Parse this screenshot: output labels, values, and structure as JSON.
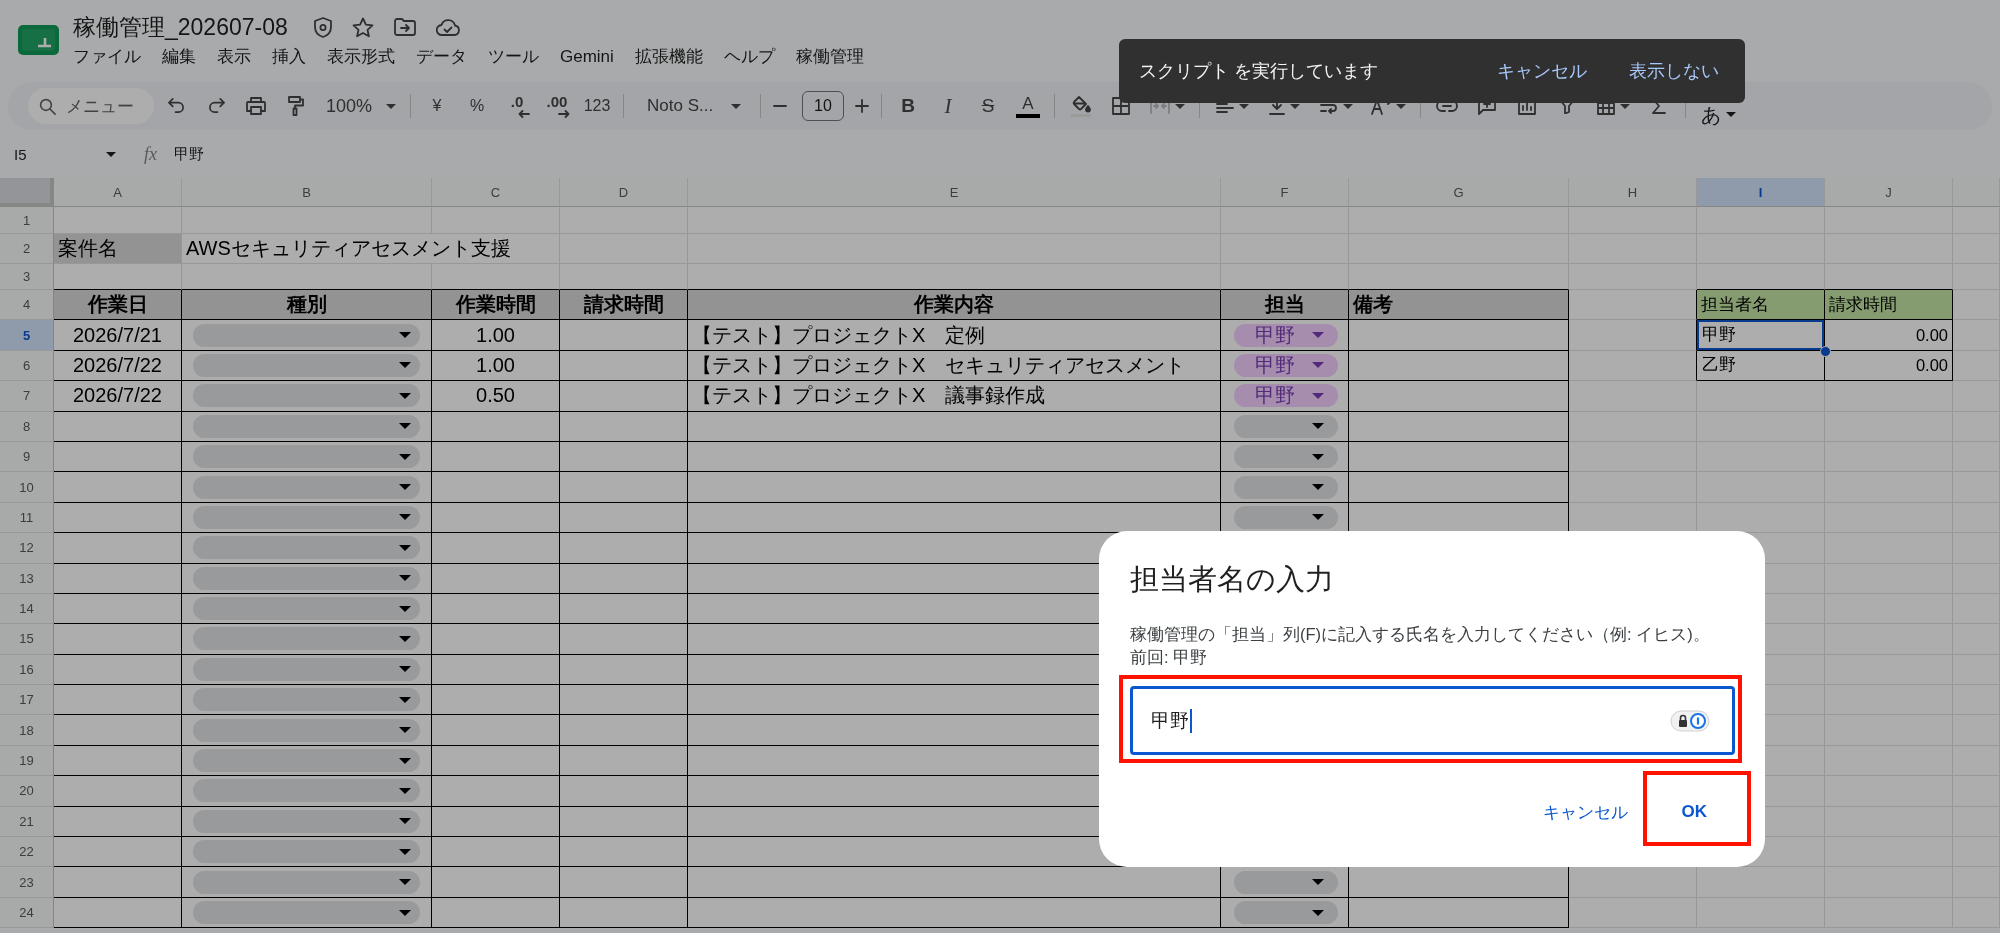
{
  "app": {
    "title": "稼働管理_202607-08",
    "menu": [
      "ファイル",
      "編集",
      "表示",
      "挿入",
      "表示形式",
      "データ",
      "ツール",
      "Gemini",
      "拡張機能",
      "ヘルプ",
      "稼働管理"
    ]
  },
  "toolbar": {
    "search": {
      "placeholder": "メニュー"
    },
    "zoom": "100%",
    "currency": "¥",
    "percent": "%",
    "decrease_decimal": ".0",
    "increase_decimal": ".00",
    "number_format": "123",
    "font": "Noto S...",
    "font_size": "10",
    "bold": "B",
    "italic": "I",
    "strikethrough": "S",
    "text_color": "A",
    "input_tools": "あ"
  },
  "formula_bar": {
    "cell": "I5",
    "symbol": "fx",
    "value": "甲野"
  },
  "sheet": {
    "columns": [
      {
        "label": "A",
        "selected": false
      },
      {
        "label": "B",
        "selected": false
      },
      {
        "label": "C",
        "selected": false
      },
      {
        "label": "D",
        "selected": false
      },
      {
        "label": "E",
        "selected": false
      },
      {
        "label": "F",
        "selected": false
      },
      {
        "label": "G",
        "selected": false
      },
      {
        "label": "H",
        "selected": false
      },
      {
        "label": "I",
        "selected": true
      },
      {
        "label": "J",
        "selected": false
      }
    ],
    "rows": [
      {
        "label": "1",
        "selected": false
      },
      {
        "label": "2",
        "selected": false
      },
      {
        "label": "3",
        "selected": false
      },
      {
        "label": "4",
        "selected": false
      },
      {
        "label": "5",
        "selected": true
      },
      {
        "label": "6",
        "selected": false
      },
      {
        "label": "7",
        "selected": false
      },
      {
        "label": "8",
        "selected": false
      },
      {
        "label": "9",
        "selected": false
      },
      {
        "label": "10",
        "selected": false
      },
      {
        "label": "11",
        "selected": false
      },
      {
        "label": "12",
        "selected": false
      },
      {
        "label": "13",
        "selected": false
      },
      {
        "label": "14",
        "selected": false
      },
      {
        "label": "15",
        "selected": false
      },
      {
        "label": "16",
        "selected": false
      },
      {
        "label": "17",
        "selected": false
      },
      {
        "label": "18",
        "selected": false
      },
      {
        "label": "19",
        "selected": false
      },
      {
        "label": "20",
        "selected": false
      },
      {
        "label": "21",
        "selected": false
      },
      {
        "label": "22",
        "selected": false
      },
      {
        "label": "23",
        "selected": false
      },
      {
        "label": "24",
        "selected": false
      }
    ],
    "project": {
      "label": "案件名",
      "value": "AWSセキュリティアセスメント支援"
    },
    "log_table": {
      "headers": [
        "作業日",
        "種別",
        "作業時間",
        "請求時間",
        "作業内容",
        "担当",
        "備考"
      ],
      "entries": [
        {
          "date": "2026/7/21",
          "type": {
            "kind": "dropdown"
          },
          "hours": "1.00",
          "content": "【テスト】プロジェクトX　定例",
          "assignee": {
            "kind": "dropdown",
            "value": "甲野"
          }
        },
        {
          "date": "2026/7/22",
          "type": {
            "kind": "dropdown"
          },
          "hours": "1.00",
          "content": "【テスト】プロジェクトX　セキュリティアセスメント",
          "assignee": {
            "kind": "dropdown",
            "value": "甲野"
          }
        },
        {
          "date": "2026/7/22",
          "type": {
            "kind": "dropdown"
          },
          "hours": "0.50",
          "content": "【テスト】プロジェクトX　議事録作成",
          "assignee": {
            "kind": "dropdown",
            "value": "甲野"
          }
        },
        {
          "type": {
            "kind": "dropdown"
          },
          "assignee": {
            "kind": "dropdown"
          }
        },
        {
          "type": {
            "kind": "dropdown"
          },
          "assignee": {
            "kind": "dropdown"
          }
        },
        {
          "type": {
            "kind": "dropdown"
          },
          "assignee": {
            "kind": "dropdown"
          }
        },
        {
          "type": {
            "kind": "dropdown"
          },
          "assignee": {
            "kind": "dropdown"
          }
        },
        {
          "type": {
            "kind": "dropdown"
          }
        },
        {
          "type": {
            "kind": "dropdown"
          }
        },
        {
          "type": {
            "kind": "dropdown"
          }
        },
        {
          "type": {
            "kind": "dropdown"
          }
        },
        {
          "type": {
            "kind": "dropdown"
          }
        },
        {
          "type": {
            "kind": "dropdown"
          }
        },
        {
          "type": {
            "kind": "dropdown"
          }
        },
        {
          "type": {
            "kind": "dropdown"
          }
        },
        {
          "type": {
            "kind": "dropdown"
          }
        },
        {
          "type": {
            "kind": "dropdown"
          }
        },
        {
          "type": {
            "kind": "dropdown"
          }
        },
        {
          "type": {
            "kind": "dropdown"
          },
          "assignee": {
            "kind": "dropdown"
          }
        },
        {
          "type": {
            "kind": "dropdown"
          },
          "assignee": {
            "kind": "dropdown"
          }
        }
      ]
    },
    "summary_table": {
      "headers": [
        "担当者名",
        "請求時間"
      ],
      "rows": [
        {
          "name": "甲野",
          "hours": "0.00",
          "selected": true
        },
        {
          "name": "乙野",
          "hours": "0.00",
          "selected": false
        }
      ]
    }
  },
  "snackbar": {
    "message": "スクリプト を実行しています",
    "actions": [
      "キャンセル",
      "表示しない"
    ]
  },
  "dialog": {
    "title": "担当者名の入力",
    "description": "稼働管理の「担当」列(F)に記入する氏名を入力してください（例: イヒス)。",
    "previous": "前回: 甲野",
    "input": {
      "value": "甲野",
      "focused": true,
      "highlighted": true
    },
    "buttons": [
      {
        "kind": "cancel",
        "label": "キャンセル",
        "highlighted": false
      },
      {
        "kind": "confirm",
        "label": "OK",
        "highlighted": true
      }
    ]
  }
}
